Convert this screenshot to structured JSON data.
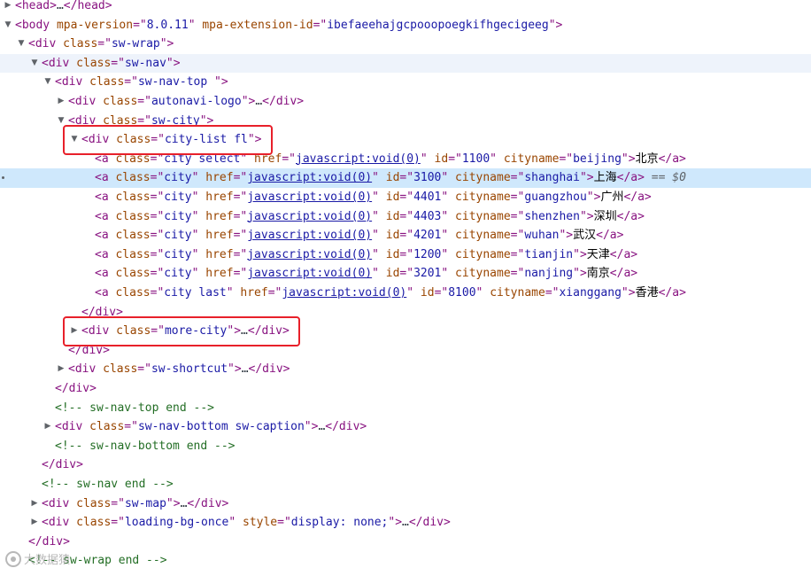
{
  "lines": [
    {
      "key": "l0",
      "depth": 0,
      "tri": "right",
      "parts": [
        [
          "tag",
          "<head>"
        ],
        [
          "ellipsis",
          "…"
        ],
        [
          "tag",
          "</head>"
        ]
      ]
    },
    {
      "key": "l1",
      "depth": 0,
      "tri": "down",
      "parts": [
        [
          "tag",
          "<body "
        ],
        [
          "attr",
          "mpa-version"
        ],
        [
          "tag",
          "=\""
        ],
        [
          "val",
          "8.0.11"
        ],
        [
          "tag",
          "\" "
        ],
        [
          "attr",
          "mpa-extension-id"
        ],
        [
          "tag",
          "=\""
        ],
        [
          "val",
          "ibefaeehajgcpooopoegkifhgecigeeg"
        ],
        [
          "tag",
          "\">"
        ]
      ]
    },
    {
      "key": "l2",
      "depth": 1,
      "tri": "down",
      "parts": [
        [
          "tag",
          "<div "
        ],
        [
          "attr",
          "class"
        ],
        [
          "tag",
          "=\""
        ],
        [
          "val",
          "sw-wrap"
        ],
        [
          "tag",
          "\">"
        ]
      ]
    },
    {
      "key": "l3",
      "depth": 2,
      "tri": "down",
      "hover": true,
      "parts": [
        [
          "tag",
          "<div "
        ],
        [
          "attr",
          "class"
        ],
        [
          "tag",
          "=\""
        ],
        [
          "val",
          "sw-nav"
        ],
        [
          "tag",
          "\">"
        ]
      ]
    },
    {
      "key": "l4",
      "depth": 3,
      "tri": "down",
      "parts": [
        [
          "tag",
          "<div "
        ],
        [
          "attr",
          "class"
        ],
        [
          "tag",
          "=\""
        ],
        [
          "val",
          "sw-nav-top "
        ],
        [
          "tag",
          "\">"
        ]
      ]
    },
    {
      "key": "l5",
      "depth": 4,
      "tri": "right",
      "parts": [
        [
          "tag",
          "<div "
        ],
        [
          "attr",
          "class"
        ],
        [
          "tag",
          "=\""
        ],
        [
          "val",
          "autonavi-logo"
        ],
        [
          "tag",
          "\">"
        ],
        [
          "ellipsis",
          "…"
        ],
        [
          "tag",
          "</div>"
        ]
      ]
    },
    {
      "key": "l6",
      "depth": 4,
      "tri": "down",
      "parts": [
        [
          "tag",
          "<div "
        ],
        [
          "attr",
          "class"
        ],
        [
          "tag",
          "=\""
        ],
        [
          "val",
          "sw-city"
        ],
        [
          "tag",
          "\">"
        ]
      ]
    },
    {
      "key": "l7",
      "depth": 5,
      "tri": "down",
      "parts": [
        [
          "tag",
          "<div "
        ],
        [
          "attr",
          "class"
        ],
        [
          "tag",
          "=\""
        ],
        [
          "val",
          "city-list fl"
        ],
        [
          "tag",
          "\">"
        ]
      ]
    },
    {
      "key": "l8",
      "depth": 6,
      "tri": "",
      "parts": [
        [
          "tag",
          "<a "
        ],
        [
          "attr",
          "class"
        ],
        [
          "tag",
          "=\""
        ],
        [
          "val",
          "city select"
        ],
        [
          "tag",
          "\" "
        ],
        [
          "attr",
          "href"
        ],
        [
          "tag",
          "=\""
        ],
        [
          "link",
          "javascript:void(0)"
        ],
        [
          "tag",
          "\" "
        ],
        [
          "attr",
          "id"
        ],
        [
          "tag",
          "=\""
        ],
        [
          "val",
          "1100"
        ],
        [
          "tag",
          "\" "
        ],
        [
          "attr",
          "cityname"
        ],
        [
          "tag",
          "=\""
        ],
        [
          "val",
          "beijing"
        ],
        [
          "tag",
          "\">"
        ],
        [
          "text",
          "北京"
        ],
        [
          "tag",
          "</a>"
        ]
      ]
    },
    {
      "key": "l9",
      "depth": 6,
      "tri": "",
      "selected": true,
      "parts": [
        [
          "tag",
          "<a "
        ],
        [
          "attr",
          "class"
        ],
        [
          "tag",
          "=\""
        ],
        [
          "val",
          "city"
        ],
        [
          "tag",
          "\" "
        ],
        [
          "attr",
          "href"
        ],
        [
          "tag",
          "=\""
        ],
        [
          "link",
          "javascript:void(0)"
        ],
        [
          "tag",
          "\" "
        ],
        [
          "attr",
          "id"
        ],
        [
          "tag",
          "=\""
        ],
        [
          "val",
          "3100"
        ],
        [
          "tag",
          "\" "
        ],
        [
          "attr",
          "cityname"
        ],
        [
          "tag",
          "=\""
        ],
        [
          "val",
          "shanghai"
        ],
        [
          "tag",
          "\">"
        ],
        [
          "text",
          "上海"
        ],
        [
          "tag",
          "</a>"
        ],
        [
          "eqsel",
          " == $0"
        ]
      ]
    },
    {
      "key": "l10",
      "depth": 6,
      "tri": "",
      "parts": [
        [
          "tag",
          "<a "
        ],
        [
          "attr",
          "class"
        ],
        [
          "tag",
          "=\""
        ],
        [
          "val",
          "city"
        ],
        [
          "tag",
          "\" "
        ],
        [
          "attr",
          "href"
        ],
        [
          "tag",
          "=\""
        ],
        [
          "link",
          "javascript:void(0)"
        ],
        [
          "tag",
          "\" "
        ],
        [
          "attr",
          "id"
        ],
        [
          "tag",
          "=\""
        ],
        [
          "val",
          "4401"
        ],
        [
          "tag",
          "\" "
        ],
        [
          "attr",
          "cityname"
        ],
        [
          "tag",
          "=\""
        ],
        [
          "val",
          "guangzhou"
        ],
        [
          "tag",
          "\">"
        ],
        [
          "text",
          "广州"
        ],
        [
          "tag",
          "</a>"
        ]
      ]
    },
    {
      "key": "l11",
      "depth": 6,
      "tri": "",
      "parts": [
        [
          "tag",
          "<a "
        ],
        [
          "attr",
          "class"
        ],
        [
          "tag",
          "=\""
        ],
        [
          "val",
          "city"
        ],
        [
          "tag",
          "\" "
        ],
        [
          "attr",
          "href"
        ],
        [
          "tag",
          "=\""
        ],
        [
          "link",
          "javascript:void(0)"
        ],
        [
          "tag",
          "\" "
        ],
        [
          "attr",
          "id"
        ],
        [
          "tag",
          "=\""
        ],
        [
          "val",
          "4403"
        ],
        [
          "tag",
          "\" "
        ],
        [
          "attr",
          "cityname"
        ],
        [
          "tag",
          "=\""
        ],
        [
          "val",
          "shenzhen"
        ],
        [
          "tag",
          "\">"
        ],
        [
          "text",
          "深圳"
        ],
        [
          "tag",
          "</a>"
        ]
      ]
    },
    {
      "key": "l12",
      "depth": 6,
      "tri": "",
      "parts": [
        [
          "tag",
          "<a "
        ],
        [
          "attr",
          "class"
        ],
        [
          "tag",
          "=\""
        ],
        [
          "val",
          "city"
        ],
        [
          "tag",
          "\" "
        ],
        [
          "attr",
          "href"
        ],
        [
          "tag",
          "=\""
        ],
        [
          "link",
          "javascript:void(0)"
        ],
        [
          "tag",
          "\" "
        ],
        [
          "attr",
          "id"
        ],
        [
          "tag",
          "=\""
        ],
        [
          "val",
          "4201"
        ],
        [
          "tag",
          "\" "
        ],
        [
          "attr",
          "cityname"
        ],
        [
          "tag",
          "=\""
        ],
        [
          "val",
          "wuhan"
        ],
        [
          "tag",
          "\">"
        ],
        [
          "text",
          "武汉"
        ],
        [
          "tag",
          "</a>"
        ]
      ]
    },
    {
      "key": "l13",
      "depth": 6,
      "tri": "",
      "parts": [
        [
          "tag",
          "<a "
        ],
        [
          "attr",
          "class"
        ],
        [
          "tag",
          "=\""
        ],
        [
          "val",
          "city"
        ],
        [
          "tag",
          "\" "
        ],
        [
          "attr",
          "href"
        ],
        [
          "tag",
          "=\""
        ],
        [
          "link",
          "javascript:void(0)"
        ],
        [
          "tag",
          "\" "
        ],
        [
          "attr",
          "id"
        ],
        [
          "tag",
          "=\""
        ],
        [
          "val",
          "1200"
        ],
        [
          "tag",
          "\" "
        ],
        [
          "attr",
          "cityname"
        ],
        [
          "tag",
          "=\""
        ],
        [
          "val",
          "tianjin"
        ],
        [
          "tag",
          "\">"
        ],
        [
          "text",
          "天津"
        ],
        [
          "tag",
          "</a>"
        ]
      ]
    },
    {
      "key": "l14",
      "depth": 6,
      "tri": "",
      "parts": [
        [
          "tag",
          "<a "
        ],
        [
          "attr",
          "class"
        ],
        [
          "tag",
          "=\""
        ],
        [
          "val",
          "city"
        ],
        [
          "tag",
          "\" "
        ],
        [
          "attr",
          "href"
        ],
        [
          "tag",
          "=\""
        ],
        [
          "link",
          "javascript:void(0)"
        ],
        [
          "tag",
          "\" "
        ],
        [
          "attr",
          "id"
        ],
        [
          "tag",
          "=\""
        ],
        [
          "val",
          "3201"
        ],
        [
          "tag",
          "\" "
        ],
        [
          "attr",
          "cityname"
        ],
        [
          "tag",
          "=\""
        ],
        [
          "val",
          "nanjing"
        ],
        [
          "tag",
          "\">"
        ],
        [
          "text",
          "南京"
        ],
        [
          "tag",
          "</a>"
        ]
      ]
    },
    {
      "key": "l15",
      "depth": 6,
      "tri": "",
      "parts": [
        [
          "tag",
          "<a "
        ],
        [
          "attr",
          "class"
        ],
        [
          "tag",
          "=\""
        ],
        [
          "val",
          "city last"
        ],
        [
          "tag",
          "\" "
        ],
        [
          "attr",
          "href"
        ],
        [
          "tag",
          "=\""
        ],
        [
          "link",
          "javascript:void(0)"
        ],
        [
          "tag",
          "\" "
        ],
        [
          "attr",
          "id"
        ],
        [
          "tag",
          "=\""
        ],
        [
          "val",
          "8100"
        ],
        [
          "tag",
          "\" "
        ],
        [
          "attr",
          "cityname"
        ],
        [
          "tag",
          "=\""
        ],
        [
          "val",
          "xianggang"
        ],
        [
          "tag",
          "\">"
        ],
        [
          "text",
          "香港"
        ],
        [
          "tag",
          "</a>"
        ]
      ]
    },
    {
      "key": "l16",
      "depth": 5,
      "tri": "",
      "parts": [
        [
          "tag",
          "</div>"
        ]
      ]
    },
    {
      "key": "l17",
      "depth": 5,
      "tri": "right",
      "parts": [
        [
          "tag",
          "<div "
        ],
        [
          "attr",
          "class"
        ],
        [
          "tag",
          "=\""
        ],
        [
          "val",
          "more-city"
        ],
        [
          "tag",
          "\">"
        ],
        [
          "ellipsis",
          "…"
        ],
        [
          "tag",
          "</div>"
        ]
      ]
    },
    {
      "key": "l18",
      "depth": 4,
      "tri": "",
      "parts": [
        [
          "tag",
          "</div>"
        ]
      ]
    },
    {
      "key": "l19",
      "depth": 4,
      "tri": "right",
      "parts": [
        [
          "tag",
          "<div "
        ],
        [
          "attr",
          "class"
        ],
        [
          "tag",
          "=\""
        ],
        [
          "val",
          "sw-shortcut"
        ],
        [
          "tag",
          "\">"
        ],
        [
          "ellipsis",
          "…"
        ],
        [
          "tag",
          "</div>"
        ]
      ]
    },
    {
      "key": "l20",
      "depth": 3,
      "tri": "",
      "parts": [
        [
          "tag",
          "</div>"
        ]
      ]
    },
    {
      "key": "l21",
      "depth": 3,
      "tri": "",
      "parts": [
        [
          "comment",
          "<!-- sw-nav-top end -->"
        ]
      ]
    },
    {
      "key": "l22",
      "depth": 3,
      "tri": "right",
      "parts": [
        [
          "tag",
          "<div "
        ],
        [
          "attr",
          "class"
        ],
        [
          "tag",
          "=\""
        ],
        [
          "val",
          "sw-nav-bottom sw-caption"
        ],
        [
          "tag",
          "\">"
        ],
        [
          "ellipsis",
          "…"
        ],
        [
          "tag",
          "</div>"
        ]
      ]
    },
    {
      "key": "l23",
      "depth": 3,
      "tri": "",
      "parts": [
        [
          "comment",
          "<!-- sw-nav-bottom end -->"
        ]
      ]
    },
    {
      "key": "l24",
      "depth": 2,
      "tri": "",
      "parts": [
        [
          "tag",
          "</div>"
        ]
      ]
    },
    {
      "key": "l25",
      "depth": 2,
      "tri": "",
      "parts": [
        [
          "comment",
          "<!-- sw-nav end -->"
        ]
      ]
    },
    {
      "key": "l26",
      "depth": 2,
      "tri": "right",
      "parts": [
        [
          "tag",
          "<div "
        ],
        [
          "attr",
          "class"
        ],
        [
          "tag",
          "=\""
        ],
        [
          "val",
          "sw-map"
        ],
        [
          "tag",
          "\">"
        ],
        [
          "ellipsis",
          "…"
        ],
        [
          "tag",
          "</div>"
        ]
      ]
    },
    {
      "key": "l27",
      "depth": 2,
      "tri": "right",
      "parts": [
        [
          "tag",
          "<div "
        ],
        [
          "attr",
          "class"
        ],
        [
          "tag",
          "=\""
        ],
        [
          "val",
          "loading-bg-once"
        ],
        [
          "tag",
          "\" "
        ],
        [
          "attr",
          "style"
        ],
        [
          "tag",
          "=\""
        ],
        [
          "val",
          "display: none;"
        ],
        [
          "tag",
          "\">"
        ],
        [
          "ellipsis",
          "…"
        ],
        [
          "tag",
          "</div>"
        ]
      ]
    },
    {
      "key": "l28",
      "depth": 1,
      "tri": "",
      "parts": [
        [
          "tag",
          "</div>"
        ]
      ]
    },
    {
      "key": "l29",
      "depth": 1,
      "tri": "",
      "parts": [
        [
          "comment",
          "<!-- sw-wrap end -->"
        ]
      ]
    }
  ],
  "highlights": [
    {
      "key": "city-list",
      "line": 7
    },
    {
      "key": "more-city",
      "line": 17
    }
  ],
  "watermark": {
    "text": "大数据猿"
  },
  "colors": {
    "tag": "#881280",
    "attribute": "#994500",
    "value": "#1a1aa6",
    "comment": "#236e25",
    "highlight_box": "#e8202a",
    "selected_row": "#cfe8fc"
  },
  "icons": {
    "expanded": "triangle-down-icon",
    "collapsed": "triangle-right-icon",
    "watermark_logo": "weibo-logo-icon"
  }
}
